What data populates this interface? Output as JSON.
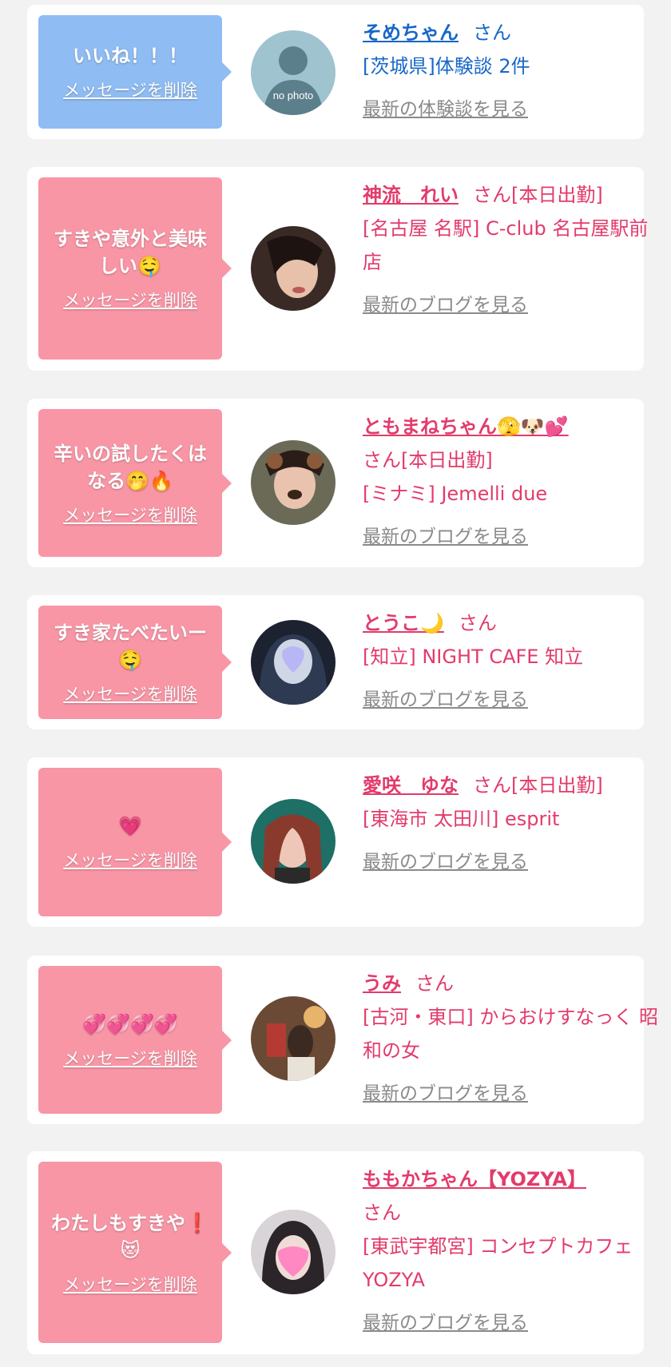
{
  "delete_label": "メッセージを削除",
  "cards": [
    {
      "message": "いいね！！！",
      "name": "そめちゃん",
      "suffix": "さん",
      "location": "[茨城県]体験談 2件",
      "more": "最新の体験談を見る",
      "avatar_text": "no photo",
      "colors": {
        "bubble": "#8fbcf2",
        "text": "#1767c8"
      }
    },
    {
      "message": "すきや意外と美味しい🤤",
      "name": "神流　れい",
      "suffix": "さん[本日出勤]",
      "location": "[名古屋 名駅] C-club 名古屋駅前店",
      "more": "最新のブログを見る"
    },
    {
      "message": "辛いの試したくはなる🤭🔥",
      "name": "ともまねちゃん🫣🐶💕",
      "suffix": "さん[本日出勤]",
      "location": "[ミナミ] Jemelli due",
      "more": "最新のブログを見る"
    },
    {
      "message": "すき家たべたいー🤤",
      "name": "とうこ🌙",
      "suffix": "さん",
      "location": "[知立] NIGHT CAFE 知立",
      "more": "最新のブログを見る"
    },
    {
      "message": "💗",
      "name": "愛咲　ゆな",
      "suffix": "さん[本日出勤]",
      "location": "[東海市 太田川] esprit",
      "more": "最新のブログを見る"
    },
    {
      "message": "💞💞💞💞",
      "name": "うみ",
      "suffix": "さん",
      "location": "[古河・東口] からおけすなっく 昭和の女",
      "more": "最新のブログを見る"
    },
    {
      "message": "わたしもすきや❗️😻",
      "name": "ももかちゃん【YOZYA】",
      "suffix": "さん",
      "location": "[東武宇都宮] コンセプトカフェYOZYA",
      "more": "最新のブログを見る"
    }
  ],
  "colors": {
    "page_bg": "#f2f2f2",
    "pink_bubble": "#f896a6",
    "pink_text": "#e23b6b",
    "link_gray": "#8a8a8a"
  }
}
